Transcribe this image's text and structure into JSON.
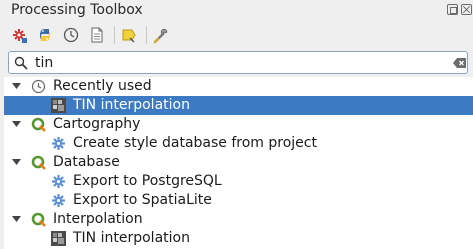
{
  "window": {
    "title": "Processing Toolbox"
  },
  "toolbar": {
    "buttons": [
      {
        "icon": "models-icon"
      },
      {
        "icon": "python-scripts-icon"
      },
      {
        "icon": "history-icon"
      },
      {
        "icon": "results-viewer-icon"
      },
      {
        "icon": "edit-features-in-place-icon"
      },
      {
        "icon": "options-icon"
      }
    ]
  },
  "search": {
    "value": "tin"
  },
  "tree": {
    "groups": [
      {
        "label": "Recently used",
        "icon": "clock-icon",
        "items": [
          {
            "label": "TIN interpolation",
            "icon": "tin-raster-icon",
            "selected": true
          }
        ]
      },
      {
        "label": "Cartography",
        "icon": "qgis-icon",
        "items": [
          {
            "label": "Create style database from project",
            "icon": "algorithm-gear-icon"
          }
        ]
      },
      {
        "label": "Database",
        "icon": "qgis-icon",
        "items": [
          {
            "label": "Export to PostgreSQL",
            "icon": "algorithm-gear-icon"
          },
          {
            "label": "Export to SpatiaLite",
            "icon": "algorithm-gear-icon"
          }
        ]
      },
      {
        "label": "Interpolation",
        "icon": "qgis-icon",
        "items": [
          {
            "label": "TIN interpolation",
            "icon": "tin-raster-icon"
          }
        ]
      }
    ]
  },
  "colors": {
    "selection": "#3d7ac4",
    "qgis_green": "#589632",
    "background": "#efefef"
  }
}
